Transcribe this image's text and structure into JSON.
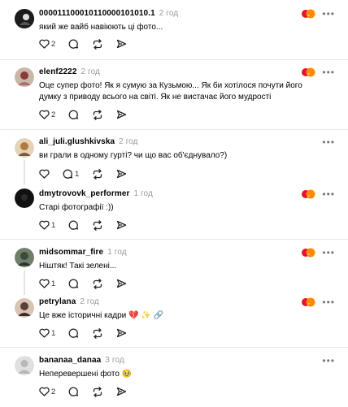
{
  "comments": [
    {
      "username": "000011100010110000101010.1",
      "time": "2 год",
      "text": "який же вайб навіюють ці фото...",
      "likes": "2",
      "replies": "",
      "avatar_color": "#1a1a1a"
    },
    {
      "username": "elenf2222",
      "time": "2 год",
      "text": "Оце супер фото! Як я сумую за Кузьмою... Як би хотілося почути його думку з приводу всього на світі. Як не вистачає його мудрості",
      "likes": "2",
      "replies": "",
      "avatar_color": "#8b3a3a"
    },
    {
      "username": "ali_juli.glushkivska",
      "time": "2 год",
      "text": "ви грали в одному гурті? чи що вас об'єднувало?)",
      "likes": "",
      "replies": "1",
      "avatar_color": "#b07a40"
    },
    {
      "username": "dmytrovovk_performer",
      "time": "1 год",
      "text": "Старі фотографії :))",
      "likes": "1",
      "replies": "",
      "avatar_color": "#111111"
    },
    {
      "username": "midsommar_fire",
      "time": "1 год",
      "text": "Ніштяк! Такі зелені...",
      "likes": "1",
      "replies": "",
      "avatar_color": "#3b4a3a"
    },
    {
      "username": "petrylana",
      "time": "2 год",
      "text": "Це вже історичні кадри 💔 ✨ 🔗",
      "likes": "1",
      "replies": "",
      "avatar_color": "#5a4038"
    },
    {
      "username": "bananaa_danaa",
      "time": "3 год",
      "text": "Неперевершені фото 🥹",
      "likes": "2",
      "replies": "",
      "avatar_color": "#c8c8c8"
    }
  ],
  "colors": {
    "badge_orange": "#ff8a00",
    "badge_red": "#e8132b",
    "divider": "#e8e8e8",
    "muted": "#9a9a9a"
  },
  "icons": {
    "like": "heart-icon",
    "reply": "comment-icon",
    "repost": "repost-icon",
    "share": "send-icon",
    "more": "more-icon",
    "badge": "author-badge-icon"
  }
}
